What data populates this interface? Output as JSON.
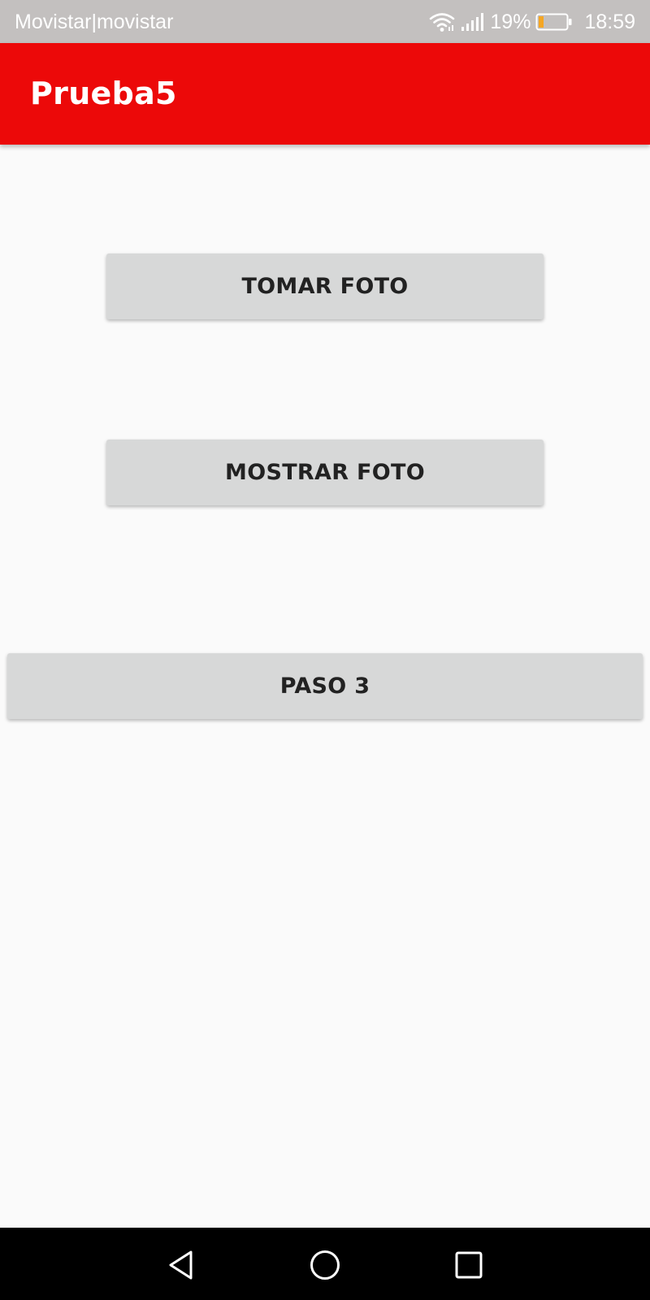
{
  "status_bar": {
    "carrier": "Movistar|movistar",
    "battery_percent": "19%",
    "battery_level": 0.19,
    "time": "18:59",
    "icons": [
      "wifi-icon",
      "signal-icon",
      "battery-icon"
    ]
  },
  "app_bar": {
    "title": "Prueba5",
    "color": "#ec0909"
  },
  "main": {
    "buttons": [
      {
        "label": "TOMAR FOTO"
      },
      {
        "label": "MOSTRAR FOTO"
      },
      {
        "label": "PASO 3"
      }
    ]
  },
  "nav_bar": {
    "icons": [
      "back-icon",
      "home-icon",
      "recents-icon"
    ]
  }
}
